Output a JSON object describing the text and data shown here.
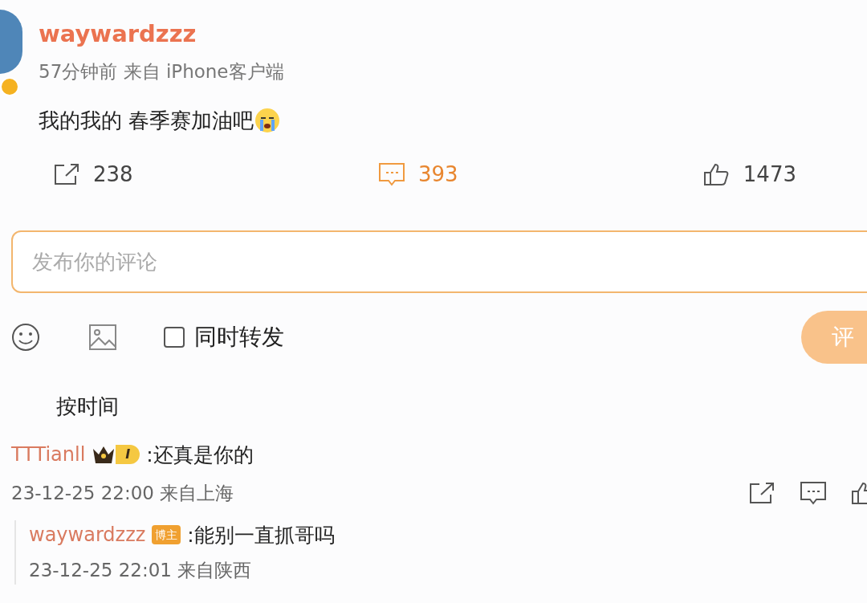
{
  "post": {
    "author": "waywardzzz",
    "verified": true,
    "meta": "57分钟前 来自 iPhone客户端",
    "text": "我的我的 春季赛加油吧"
  },
  "actions": [
    {
      "kind": "repost",
      "count": "238",
      "active": false
    },
    {
      "kind": "comment",
      "count": "393",
      "active": true
    },
    {
      "kind": "like",
      "count": "1473",
      "active": false
    }
  ],
  "comment_box": {
    "placeholder": "发布你的评论",
    "repost_too": {
      "label": "同时转发",
      "checked": false
    },
    "submit": "评"
  },
  "sort_tabs": [
    {
      "label": "按时间",
      "selected": false
    }
  ],
  "comments": [
    {
      "author": "TTTianll",
      "level": "I",
      "text": ":还真是你的",
      "meta": "23-12-25 22:00 来自上海",
      "replies": [
        {
          "author": "waywardzzz",
          "badge": "博主",
          "text": ":能别一直抓哥吗",
          "meta": "23-12-25 22:01 来自陕西"
        }
      ]
    }
  ]
}
